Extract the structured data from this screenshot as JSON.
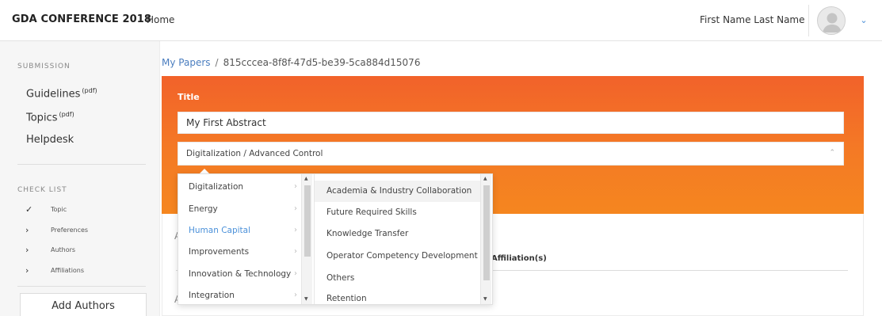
{
  "header": {
    "brand": "GDA CONFERENCE 2018",
    "nav_home": "Home",
    "user_name": "First Name Last Name",
    "user_menu_chevron": "chevron-down-icon"
  },
  "sidebar": {
    "submission_heading": "SUBMISSION",
    "links": [
      {
        "label": "Guidelines",
        "sup": "(pdf)"
      },
      {
        "label": "Topics",
        "sup": "(pdf)"
      },
      {
        "label": "Helpdesk",
        "sup": ""
      }
    ],
    "checklist_heading": "CHECK LIST",
    "checklist": [
      {
        "label": "Topic",
        "icon": "check-icon",
        "mark": "✓"
      },
      {
        "label": "Preferences",
        "icon": "chevron-right-icon",
        "mark": "›"
      },
      {
        "label": "Authors",
        "icon": "chevron-right-icon",
        "mark": "›"
      },
      {
        "label": "Affiliations",
        "icon": "chevron-right-icon",
        "mark": "›"
      }
    ],
    "add_authors": "Add Authors"
  },
  "breadcrumb": {
    "parent": "My Papers",
    "separator": "/",
    "current": "815cccea-8f8f-47d5-be39-5ca884d15076"
  },
  "form": {
    "title_label": "Title",
    "title_value": "My First Abstract",
    "topic_value": "Digitalization / Advanced Control"
  },
  "card": {
    "letters": [
      "A",
      "A"
    ],
    "affiliation_header": "Affiliation(s)"
  },
  "cascade": {
    "categories": [
      {
        "label": "Digitalization",
        "active": false
      },
      {
        "label": "Energy",
        "active": false
      },
      {
        "label": "Human Capital",
        "active": true
      },
      {
        "label": "Improvements",
        "active": false
      },
      {
        "label": "Innovation & Technology",
        "active": false
      },
      {
        "label": "Integration",
        "active": false
      }
    ],
    "subtopics": [
      "Academia & Industry Collaboration",
      "Future Required Skills",
      "Knowledge Transfer",
      "Operator Competency Development",
      "Others",
      "Retention"
    ],
    "highlighted_subtopic_index": 0
  },
  "colors": {
    "orange_top": "#f2622a",
    "orange_bottom": "#f5861f",
    "link_blue": "#4a7dbf",
    "active_blue": "#4a90d9"
  }
}
